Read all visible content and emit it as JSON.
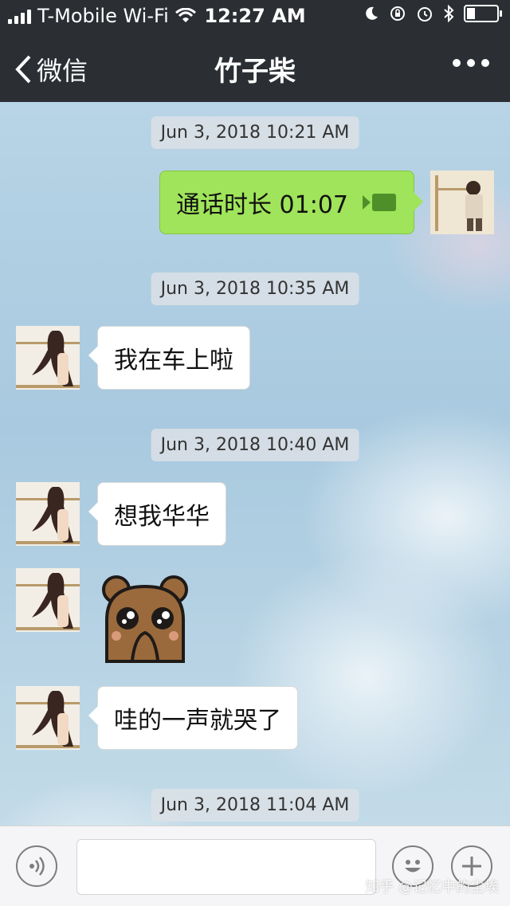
{
  "status_bar": {
    "carrier": "T-Mobile Wi-Fi",
    "time": "12:27 AM"
  },
  "nav": {
    "back_label": "微信",
    "title": "竹子柴"
  },
  "messages": [
    {
      "type": "timestamp",
      "text": "Jun 3, 2018 10:21 AM"
    },
    {
      "type": "call",
      "sender": "self",
      "text": "通话时长 01:07"
    },
    {
      "type": "timestamp",
      "text": "Jun 3, 2018 10:35 AM"
    },
    {
      "type": "text",
      "sender": "other",
      "text": "我在车上啦"
    },
    {
      "type": "timestamp",
      "text": "Jun 3, 2018 10:40 AM"
    },
    {
      "type": "text",
      "sender": "other",
      "text": "想我华华"
    },
    {
      "type": "sticker",
      "sender": "other",
      "icon": "crying-bear-sticker"
    },
    {
      "type": "text",
      "sender": "other",
      "text": "哇的一声就哭了"
    },
    {
      "type": "timestamp",
      "text": "Jun 3, 2018 11:04 AM"
    }
  ],
  "watermark": "知乎 @记忆中的尘埃",
  "colors": {
    "header_bg": "#2b2f34",
    "self_bubble": "#9fe45a",
    "other_bubble": "#ffffff"
  }
}
